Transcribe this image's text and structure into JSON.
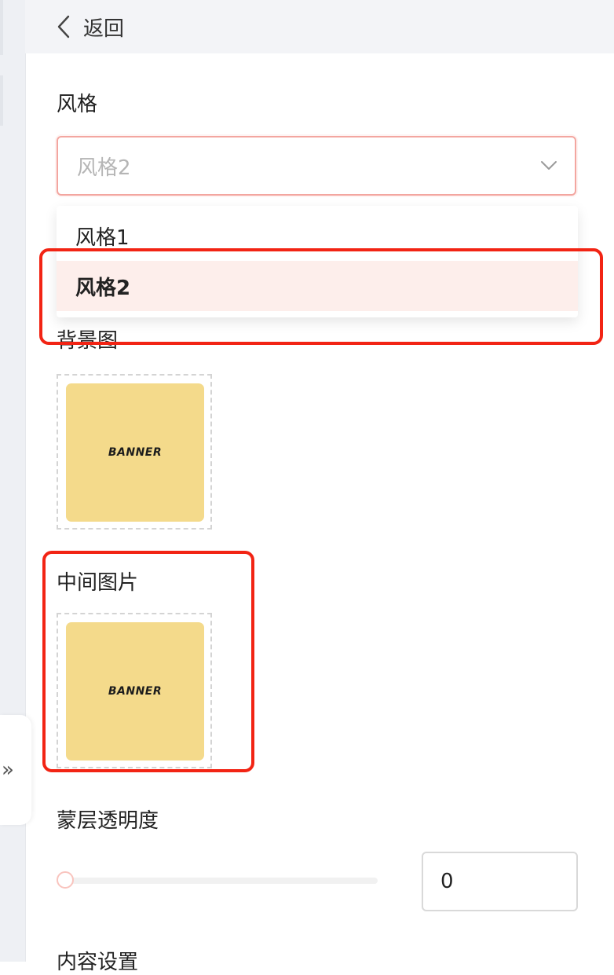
{
  "header": {
    "back_label": "返回",
    "back_icon": "chevron-left-icon"
  },
  "style_section": {
    "label": "风格",
    "selected_value": "风格2",
    "options": [
      {
        "label": "风格1",
        "selected": false
      },
      {
        "label": "风格2",
        "selected": true
      }
    ],
    "caret_icon": "chevron-down-icon"
  },
  "background_section": {
    "label": "背景图",
    "image_text": "BANNER"
  },
  "middle_image_section": {
    "label": "中间图片",
    "image_text": "BANNER"
  },
  "overlay_opacity": {
    "label": "蒙层透明度",
    "value": "0",
    "slider_fraction": 0
  },
  "content_settings": {
    "label": "内容设置"
  },
  "sidebar": {
    "collapse_glyph": "»",
    "collapse_icon": "double-chevron-right-icon"
  },
  "colors": {
    "accent": "#f56e64",
    "highlight_box": "#f22414",
    "selected_option_bg": "#fdeeeb",
    "banner_thumb": "#f4da8b",
    "header_bg": "#f3f4f7"
  }
}
